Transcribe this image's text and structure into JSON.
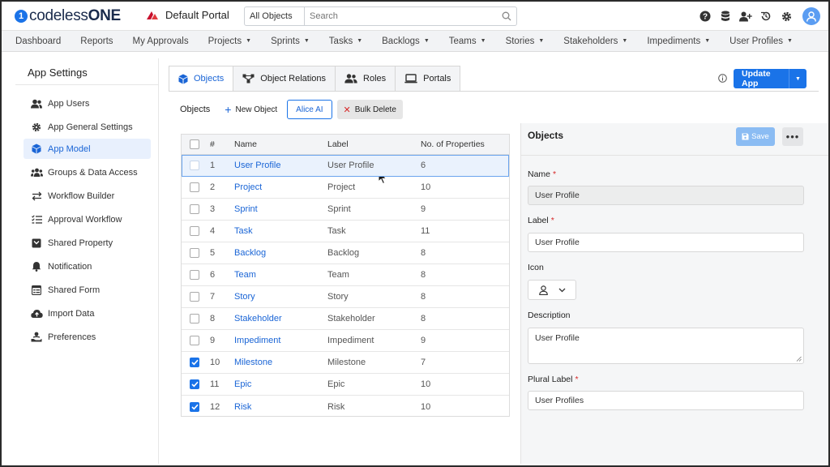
{
  "app": {
    "logo_prefix": "codeless",
    "logo_suffix": "ONE",
    "portal": "Default Portal",
    "search_scope": "All Objects",
    "search_placeholder": "Search"
  },
  "nav": [
    {
      "label": "Dashboard",
      "dropdown": false
    },
    {
      "label": "Reports",
      "dropdown": false
    },
    {
      "label": "My Approvals",
      "dropdown": false
    },
    {
      "label": "Projects",
      "dropdown": true
    },
    {
      "label": "Sprints",
      "dropdown": true
    },
    {
      "label": "Tasks",
      "dropdown": true
    },
    {
      "label": "Backlogs",
      "dropdown": true
    },
    {
      "label": "Teams",
      "dropdown": true
    },
    {
      "label": "Stories",
      "dropdown": true
    },
    {
      "label": "Stakeholders",
      "dropdown": true
    },
    {
      "label": "Impediments",
      "dropdown": true
    },
    {
      "label": "User Profiles",
      "dropdown": true
    }
  ],
  "sidebar": {
    "title": "App Settings",
    "items": [
      {
        "label": "App Users",
        "icon": "users-icon",
        "active": false
      },
      {
        "label": "App General Settings",
        "icon": "gear-icon",
        "active": false
      },
      {
        "label": "App Model",
        "icon": "cube-icon",
        "active": true
      },
      {
        "label": "Groups & Data Access",
        "icon": "group-icon",
        "active": false
      },
      {
        "label": "Workflow Builder",
        "icon": "workflow-icon",
        "active": false
      },
      {
        "label": "Approval Workflow",
        "icon": "checklist-icon",
        "active": false
      },
      {
        "label": "Shared Property",
        "icon": "shared-property-icon",
        "active": false
      },
      {
        "label": "Notification",
        "icon": "bell-icon",
        "active": false
      },
      {
        "label": "Shared Form",
        "icon": "form-icon",
        "active": false
      },
      {
        "label": "Import Data",
        "icon": "cloud-upload-icon",
        "active": false
      },
      {
        "label": "Preferences",
        "icon": "preferences-icon",
        "active": false
      }
    ]
  },
  "tabs": [
    {
      "label": "Objects",
      "icon": "cube-icon",
      "active": true
    },
    {
      "label": "Object Relations",
      "icon": "relations-icon",
      "active": false
    },
    {
      "label": "Roles",
      "icon": "roles-icon",
      "active": false
    },
    {
      "label": "Portals",
      "icon": "laptop-icon",
      "active": false
    }
  ],
  "update_button": "Update App",
  "toolbar": {
    "label": "Objects",
    "new_object": "New Object",
    "alice_ai": "Alice AI",
    "bulk_delete": "Bulk Delete"
  },
  "table": {
    "columns": {
      "num": "#",
      "name": "Name",
      "label": "Label",
      "props": "No. of Properties"
    },
    "rows": [
      {
        "num": "1",
        "name": "User Profile",
        "label": "User Profile",
        "props": "6",
        "checked": false,
        "selected": true
      },
      {
        "num": "2",
        "name": "Project",
        "label": "Project",
        "props": "10",
        "checked": false,
        "selected": false
      },
      {
        "num": "3",
        "name": "Sprint",
        "label": "Sprint",
        "props": "9",
        "checked": false,
        "selected": false
      },
      {
        "num": "4",
        "name": "Task",
        "label": "Task",
        "props": "11",
        "checked": false,
        "selected": false
      },
      {
        "num": "5",
        "name": "Backlog",
        "label": "Backlog",
        "props": "8",
        "checked": false,
        "selected": false
      },
      {
        "num": "6",
        "name": "Team",
        "label": "Team",
        "props": "8",
        "checked": false,
        "selected": false
      },
      {
        "num": "7",
        "name": "Story",
        "label": "Story",
        "props": "8",
        "checked": false,
        "selected": false
      },
      {
        "num": "8",
        "name": "Stakeholder",
        "label": "Stakeholder",
        "props": "8",
        "checked": false,
        "selected": false
      },
      {
        "num": "9",
        "name": "Impediment",
        "label": "Impediment",
        "props": "9",
        "checked": false,
        "selected": false
      },
      {
        "num": "10",
        "name": "Milestone",
        "label": "Milestone",
        "props": "7",
        "checked": true,
        "selected": false
      },
      {
        "num": "11",
        "name": "Epic",
        "label": "Epic",
        "props": "10",
        "checked": true,
        "selected": false
      },
      {
        "num": "12",
        "name": "Risk",
        "label": "Risk",
        "props": "10",
        "checked": true,
        "selected": false
      }
    ]
  },
  "panel": {
    "title": "Objects",
    "save": "Save",
    "more": "•••",
    "name_label": "Name",
    "name_value": "User Profile",
    "label_label": "Label",
    "label_value": "User Profile",
    "icon_label": "Icon",
    "icon_value": "user-icon",
    "description_label": "Description",
    "description_value": "User Profile",
    "plural_label": "Plural Label",
    "plural_value": "User Profiles",
    "required_mark": "*"
  },
  "colors": {
    "accent": "#1a73e8",
    "link": "#1a65d6",
    "danger": "#d62828"
  }
}
